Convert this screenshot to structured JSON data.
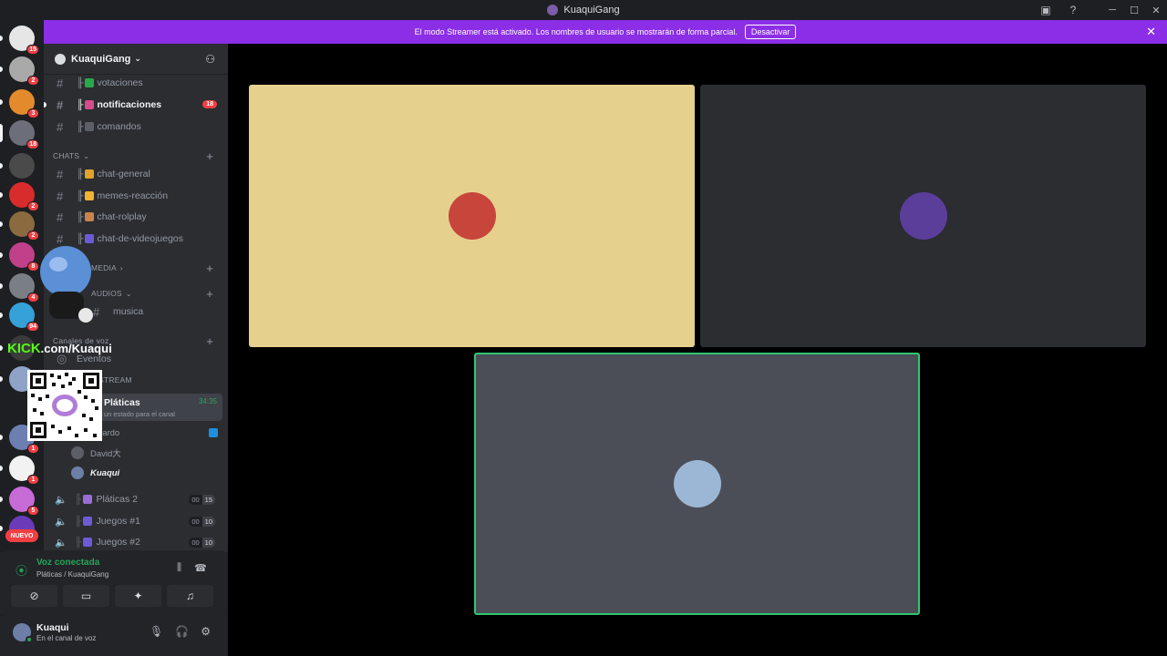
{
  "window": {
    "title": "KuaquiGang"
  },
  "guilds": [
    {
      "color": "#e6e6e6",
      "badge": "15"
    },
    {
      "color": "#a9a9a9",
      "badge": "2"
    },
    {
      "color": "#e38b2c",
      "badge": "3"
    },
    {
      "color": "#6c6f7a",
      "badge": "18"
    },
    {
      "color": "#4a4a4a",
      "badge": ""
    },
    {
      "color": "#d82b2b",
      "badge": "2"
    },
    {
      "color": "#8a6a3e",
      "badge": "2"
    },
    {
      "color": "#c0408a",
      "badge": "8"
    },
    {
      "color": "#7a7f86",
      "badge": "4"
    },
    {
      "color": "#36a0d8",
      "badge": "94"
    },
    {
      "color": "#3b3b3b",
      "badge": ""
    },
    {
      "color": "#8fa3c8",
      "badge": ""
    },
    {
      "color": "#6c7fb0",
      "badge": "1"
    },
    {
      "color": "#f2f2f2",
      "badge": "1"
    },
    {
      "color": "#c76bd6",
      "badge": "5"
    },
    {
      "color": "#6a3bb8",
      "badge": ""
    }
  ],
  "nuevo_label": "NUEVO",
  "banner": {
    "message": "El modo Streamer está activado. Los nombres de usuario se mostrarán de forma parcial.",
    "button": "Desactivar"
  },
  "server": {
    "name": "KuaquiGang"
  },
  "channels_top": [
    {
      "prefix": "╟",
      "emoji_color": "#2aa84a",
      "name": "votaciones",
      "unread": false,
      "count": ""
    },
    {
      "prefix": "╟",
      "emoji_color": "#d84a8a",
      "name": "notificaciones",
      "unread": true,
      "count": "18"
    },
    {
      "prefix": "╟",
      "emoji_color": "#5c5f66",
      "name": "comandos",
      "unread": false,
      "count": ""
    }
  ],
  "categories": {
    "chats": "CHATS",
    "media": "MEDIA",
    "audios": "AUDIOS",
    "voice": "Canales de voz",
    "stream": "STREAM"
  },
  "channels_chats": [
    {
      "prefix": "╟",
      "emoji_color": "#e3a22c",
      "name": "chat-general"
    },
    {
      "prefix": "╟",
      "emoji_color": "#f2b233",
      "name": "memes-reacción"
    },
    {
      "prefix": "╟",
      "emoji_color": "#c9834a",
      "name": "chat-rolplay"
    },
    {
      "prefix": "╟",
      "emoji_color": "#6c5bd6",
      "name": "chat-de-videojuegos"
    }
  ],
  "channel_music": "musica",
  "channel_events": "Eventos",
  "active_voice": {
    "name": "Pláticas",
    "timer": "34:35",
    "status_hint": "un estado para el canal"
  },
  "voice_users": [
    {
      "name": "amardo",
      "me": false
    },
    {
      "name": "David大",
      "me": false
    },
    {
      "name": "Kuaqui",
      "me": true
    }
  ],
  "voice_channels": [
    {
      "emoji_color": "#9b6bd6",
      "name": "Pláticas 2",
      "left": "00",
      "right": "15"
    },
    {
      "emoji_color": "#6c5bd6",
      "name": "Juegos #1",
      "left": "00",
      "right": "10"
    },
    {
      "emoji_color": "#6c5bd6",
      "name": "Juegos #2",
      "left": "00",
      "right": "10"
    }
  ],
  "voice_panel": {
    "status": "Voz conectada",
    "location": "Pláticas / KuaquiGang"
  },
  "user": {
    "name": "Kuaqui",
    "status": "En el canal de voz"
  },
  "overlay": {
    "kick_prefix": "KICK",
    "kick_rest": ".com/Kuaqui"
  },
  "tiles": [
    {
      "bg": "#e6d08e",
      "avatar_color": "#c7453b"
    },
    {
      "bg": "#2b2d31",
      "avatar_color": "#5a3e9a"
    },
    {
      "bg": "#4c4e57",
      "avatar_color": "#9cb7d6"
    }
  ],
  "colors": {
    "streamer_banner": "#8b2ee6",
    "speaking_outline": "#2dc770",
    "connected_green": "#23a55a",
    "mention_red": "#f23f43"
  }
}
